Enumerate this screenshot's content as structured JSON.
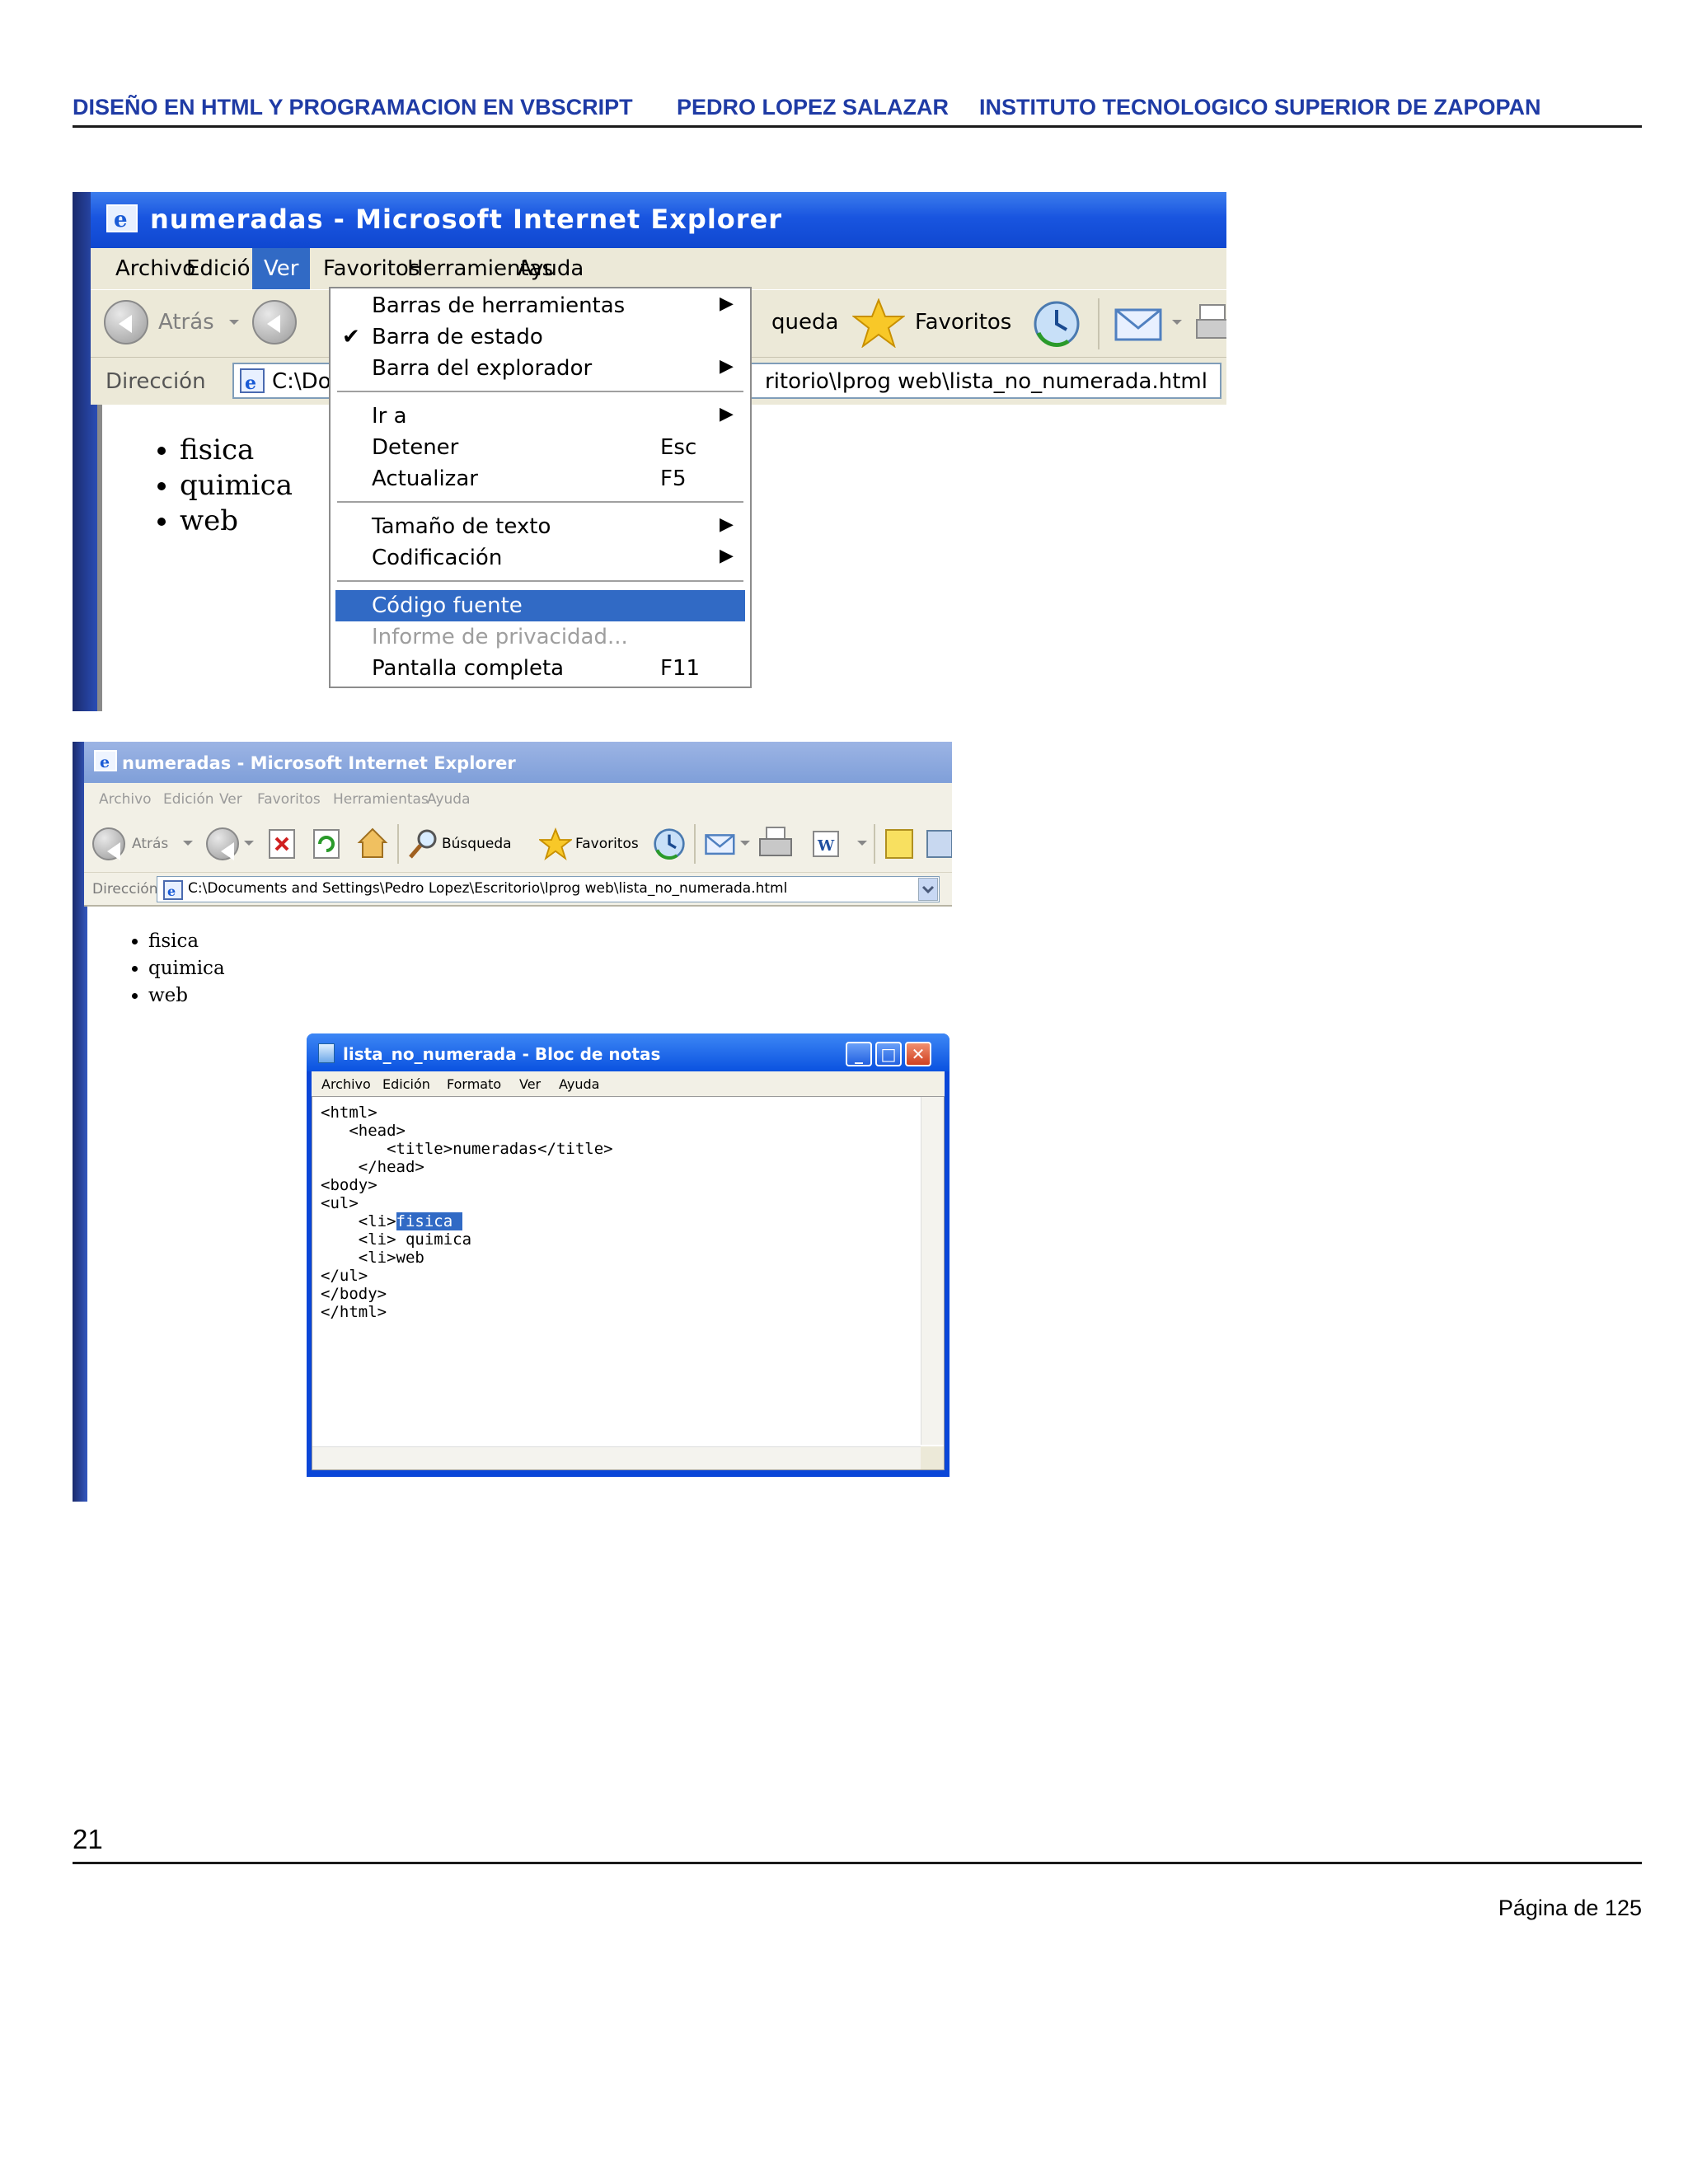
{
  "header": {
    "left": "DISEÑO EN HTML Y PROGRAMACION EN  VBSCRIPT",
    "middle": "PEDRO LOPEZ SALAZAR",
    "right": "INSTITUTO  TECNOLOGICO SUPERIOR DE ZAPOPAN"
  },
  "footer": {
    "page_number": "21",
    "page_of": "Página  de 125"
  },
  "shot1": {
    "window_title": "numeradas - Microsoft Internet Explorer",
    "menus": [
      "Archivo",
      "Edición",
      "Ver",
      "Favoritos",
      "Herramientas",
      "Ayuda"
    ],
    "toolbar": {
      "back": "Atrás",
      "search_partial": "queda",
      "favorites": "Favoritos"
    },
    "address_label": "Dirección",
    "address_part1": "C:\\Do",
    "address_part2": "ritorio\\lprog web\\lista_no_numerada.html",
    "list": [
      "fisica",
      "quimica",
      "web"
    ],
    "ver_menu": {
      "items": [
        {
          "label": "Barras de herramientas",
          "submenu": "▶"
        },
        {
          "label": "Barra de estado",
          "check": "✔"
        },
        {
          "label": "Barra del explorador",
          "submenu": "▶"
        },
        {
          "label": "Ir a",
          "submenu": "▶"
        },
        {
          "label": "Detener",
          "shortcut": "Esc"
        },
        {
          "label": "Actualizar",
          "shortcut": "F5"
        },
        {
          "label": "Tamaño de texto",
          "submenu": "▶"
        },
        {
          "label": "Codificación",
          "submenu": "▶"
        },
        {
          "label": "Código fuente"
        },
        {
          "label": "Informe de privacidad..."
        },
        {
          "label": "Pantalla completa",
          "shortcut": "F11"
        }
      ]
    }
  },
  "shot2": {
    "window_title": "numeradas - Microsoft Internet Explorer",
    "menus": [
      "Archivo",
      "Edición",
      "Ver",
      "Favoritos",
      "Herramientas",
      "Ayuda"
    ],
    "toolbar": {
      "back": "Atrás",
      "search": "Búsqueda",
      "favorites": "Favoritos"
    },
    "address_label": "Dirección",
    "address": "C:\\Documents and Settings\\Pedro Lopez\\Escritorio\\lprog web\\lista_no_numerada.html",
    "list": [
      "fisica",
      "quimica",
      "web"
    ],
    "notepad": {
      "title": "lista_no_numerada - Bloc de notas",
      "menus": [
        "Archivo",
        "Edición",
        "Formato",
        "Ver",
        "Ayuda"
      ],
      "buttons": {
        "minimize": "_",
        "maximize": "□",
        "close": "✕"
      },
      "code": {
        "l1": "<html>",
        "l2": "   <head>",
        "l3": "       <title>numeradas</title>",
        "l4": "    </head>",
        "l5": "<body>",
        "l6": "",
        "l7": "<ul>",
        "l8a": "    <li>",
        "l8b": "fisica ",
        "l9": "    <li> quimica",
        "l10": "    <li>web",
        "l11": "",
        "l12": "</ul>",
        "l13": "",
        "l14": "</body>",
        "l15": "</html>"
      }
    }
  }
}
